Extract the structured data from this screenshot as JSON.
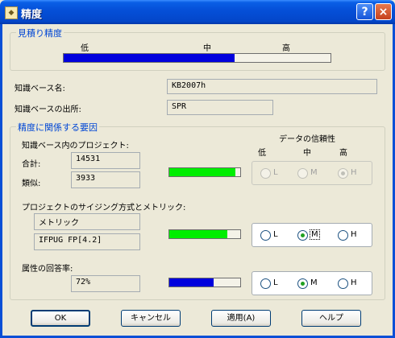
{
  "window": {
    "title": "精度",
    "help_icon": "?",
    "close_icon": "×"
  },
  "estimate_accuracy": {
    "title": "見積り精度",
    "low": "低",
    "mid": "中",
    "high": "高",
    "level": 0.64,
    "bar_color": "#0000DD"
  },
  "kb_name": {
    "label": "知識ベース名:",
    "value": "KB2007h"
  },
  "kb_source": {
    "label": "知識ベースの出所:",
    "value": "SPR"
  },
  "factors": {
    "title": "精度に関係する要因",
    "reliability_header": "データの信頼性",
    "low": "低",
    "mid": "中",
    "high": "高",
    "projects_label": "知識ベース内のプロジェクト:",
    "total_label": "合計:",
    "total_value": "14531",
    "similar_label": "類似:",
    "similar_value": "3933",
    "projects_level": 0.93,
    "projects_radio": {
      "l": "L",
      "m": "M",
      "h": "H",
      "selected": "H",
      "enabled": false
    },
    "sizing_label": "プロジェクトのサイジング方式とメトリック:",
    "sizing_method": "メトリック",
    "sizing_metric": "IFPUG FP[4.2]",
    "sizing_level": 0.82,
    "sizing_radio": {
      "l": "L",
      "m": "M",
      "h": "H",
      "selected": "M",
      "enabled": true
    },
    "response_label": "属性の回答率:",
    "response_value": "72%",
    "response_level": 0.62,
    "response_radio": {
      "l": "L",
      "m": "M",
      "h": "H",
      "selected": "M",
      "enabled": true
    },
    "green": "#00EE00",
    "blue": "#0000DD"
  },
  "buttons": {
    "ok": "OK",
    "cancel": "キャンセル",
    "apply": "適用(A)",
    "help": "ヘルプ"
  }
}
